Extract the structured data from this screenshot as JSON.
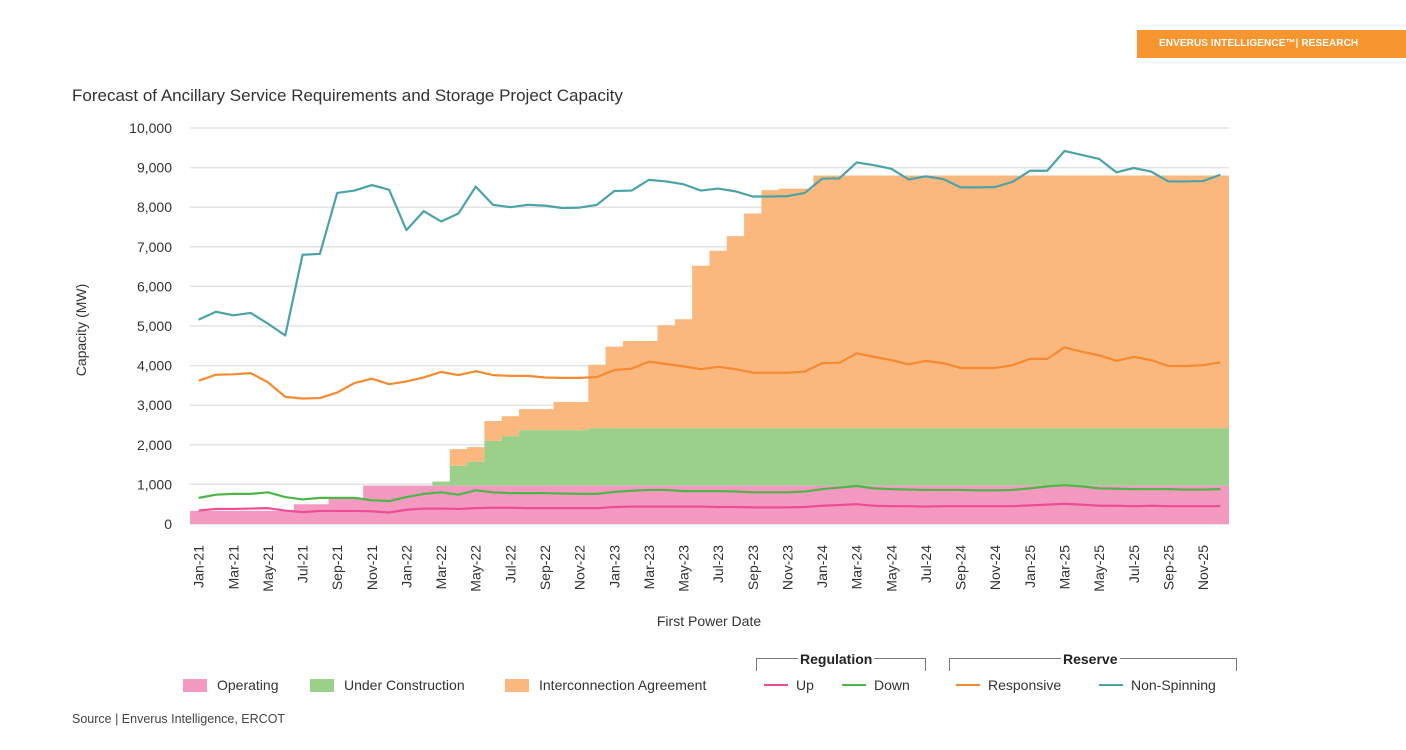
{
  "brand": {
    "label": "ENVERUS INTELLIGENCE™| RESEARCH",
    "color": "#f7952e"
  },
  "source": "Source | Enverus Intelligence, ERCOT",
  "legend_groups": {
    "regulation": "Regulation",
    "reserve": "Reserve"
  },
  "chart_data": {
    "type": "area",
    "title": "Forecast of Ancillary Service Requirements and Storage Project Capacity",
    "xlabel": "First Power Date",
    "ylabel": "Capacity (MW)",
    "ylim": [
      0,
      10000
    ],
    "yticks": [
      0,
      1000,
      2000,
      3000,
      4000,
      5000,
      6000,
      7000,
      8000,
      9000,
      10000
    ],
    "ytick_labels": [
      "0",
      "1,000",
      "2,000",
      "3,000",
      "4,000",
      "5,000",
      "6,000",
      "7,000",
      "8,000",
      "9,000",
      "10,000"
    ],
    "grid": true,
    "legend_position": "bottom",
    "x": [
      "Jan-21",
      "Feb-21",
      "Mar-21",
      "Apr-21",
      "May-21",
      "Jun-21",
      "Jul-21",
      "Aug-21",
      "Sep-21",
      "Oct-21",
      "Nov-21",
      "Dec-21",
      "Jan-22",
      "Feb-22",
      "Mar-22",
      "Apr-22",
      "May-22",
      "Jun-22",
      "Jul-22",
      "Aug-22",
      "Sep-22",
      "Oct-22",
      "Nov-22",
      "Dec-22",
      "Jan-23",
      "Feb-23",
      "Mar-23",
      "Apr-23",
      "May-23",
      "Jun-23",
      "Jul-23",
      "Aug-23",
      "Sep-23",
      "Oct-23",
      "Nov-23",
      "Dec-23",
      "Jan-24",
      "Feb-24",
      "Mar-24",
      "Apr-24",
      "May-24",
      "Jun-24",
      "Jul-24",
      "Aug-24",
      "Sep-24",
      "Oct-24",
      "Nov-24",
      "Dec-24",
      "Jan-25",
      "Feb-25",
      "Mar-25",
      "Apr-25",
      "May-25",
      "Jun-25",
      "Jul-25",
      "Aug-25",
      "Sep-25",
      "Oct-25",
      "Nov-25",
      "Dec-25"
    ],
    "xtick_labels": [
      "Jan-21",
      "Mar-21",
      "May-21",
      "Jul-21",
      "Sep-21",
      "Nov-21",
      "Jan-22",
      "Mar-22",
      "May-22",
      "Jul-22",
      "Sep-22",
      "Nov-22",
      "Jan-23",
      "Mar-23",
      "May-23",
      "Jul-23",
      "Sep-23",
      "Nov-23",
      "Jan-24",
      "Mar-24",
      "May-24",
      "Jul-24",
      "Sep-24",
      "Nov-24",
      "Jan-25",
      "Mar-25",
      "May-25",
      "Jul-25",
      "Sep-25",
      "Nov-25"
    ],
    "stacked_areas": [
      {
        "name": "Operating",
        "color": "#f49ac1",
        "values": [
          330,
          330,
          330,
          330,
          330,
          330,
          500,
          500,
          660,
          660,
          970,
          970,
          970,
          970,
          970,
          970,
          970,
          970,
          970,
          970,
          970,
          970,
          970,
          970,
          970,
          970,
          970,
          970,
          970,
          970,
          970,
          970,
          970,
          970,
          970,
          970,
          970,
          970,
          970,
          970,
          970,
          970,
          970,
          970,
          970,
          970,
          970,
          970,
          970,
          970,
          970,
          970,
          970,
          970,
          970,
          970,
          970,
          970,
          970,
          970
        ]
      },
      {
        "name": "Under Construction",
        "color": "#9bd08b",
        "values": [
          0,
          0,
          0,
          0,
          0,
          0,
          0,
          0,
          0,
          0,
          0,
          0,
          0,
          0,
          100,
          500,
          600,
          1130,
          1250,
          1400,
          1400,
          1400,
          1400,
          1450,
          1450,
          1450,
          1450,
          1450,
          1450,
          1450,
          1450,
          1450,
          1450,
          1450,
          1450,
          1450,
          1450,
          1450,
          1450,
          1450,
          1450,
          1450,
          1450,
          1450,
          1450,
          1450,
          1450,
          1450,
          1450,
          1450,
          1450,
          1450,
          1450,
          1450,
          1450,
          1450,
          1450,
          1450,
          1450,
          1450
        ]
      },
      {
        "name": "Interconnection Agreement",
        "color": "#fab87e",
        "values": [
          0,
          0,
          0,
          0,
          0,
          0,
          0,
          0,
          0,
          0,
          0,
          0,
          0,
          0,
          0,
          420,
          370,
          500,
          500,
          530,
          530,
          710,
          710,
          1600,
          2060,
          2200,
          2200,
          2600,
          2750,
          4100,
          4480,
          4850,
          5420,
          6010,
          6050,
          6050,
          6380,
          6380,
          6380,
          6380,
          6380,
          6380,
          6380,
          6380,
          6380,
          6380,
          6380,
          6380,
          6380,
          6380,
          6380,
          6380,
          6380,
          6380,
          6380,
          6380,
          6380,
          6380,
          6380,
          6380
        ]
      }
    ],
    "lines": [
      {
        "name": "Up",
        "group": "Regulation",
        "color": "#ec4d94",
        "values": [
          340,
          380,
          380,
          390,
          400,
          340,
          300,
          330,
          330,
          330,
          320,
          290,
          360,
          390,
          390,
          380,
          400,
          410,
          410,
          400,
          400,
          400,
          400,
          400,
          430,
          440,
          440,
          440,
          440,
          440,
          430,
          430,
          420,
          420,
          420,
          430,
          460,
          480,
          500,
          460,
          450,
          450,
          440,
          450,
          450,
          450,
          450,
          450,
          470,
          490,
          510,
          490,
          460,
          460,
          450,
          460,
          450,
          450,
          450,
          450
        ]
      },
      {
        "name": "Down",
        "group": "Regulation",
        "color": "#4cb749",
        "values": [
          660,
          740,
          760,
          760,
          800,
          680,
          620,
          660,
          660,
          660,
          600,
          580,
          680,
          760,
          800,
          740,
          850,
          800,
          780,
          780,
          780,
          770,
          760,
          760,
          810,
          840,
          860,
          860,
          830,
          830,
          830,
          820,
          800,
          800,
          800,
          820,
          880,
          920,
          960,
          900,
          880,
          870,
          860,
          860,
          860,
          850,
          850,
          860,
          900,
          950,
          980,
          950,
          900,
          890,
          880,
          880,
          880,
          870,
          870,
          880
        ]
      },
      {
        "name": "Responsive",
        "group": "Reserve",
        "color": "#f58a2e",
        "values": [
          3620,
          3770,
          3780,
          3810,
          3580,
          3210,
          3170,
          3180,
          3320,
          3560,
          3670,
          3530,
          3600,
          3700,
          3840,
          3760,
          3860,
          3760,
          3740,
          3740,
          3700,
          3690,
          3690,
          3710,
          3890,
          3920,
          4100,
          4040,
          3980,
          3910,
          3970,
          3910,
          3820,
          3820,
          3820,
          3850,
          4060,
          4070,
          4310,
          4220,
          4140,
          4030,
          4120,
          4060,
          3940,
          3940,
          3940,
          4010,
          4170,
          4170,
          4460,
          4350,
          4260,
          4120,
          4220,
          4140,
          3990,
          3990,
          4010,
          4080
        ]
      },
      {
        "name": "Non-Spinning",
        "group": "Reserve",
        "color": "#4ba3a8",
        "values": [
          5160,
          5360,
          5270,
          5330,
          5060,
          4760,
          6800,
          6820,
          8360,
          8420,
          8560,
          8440,
          7420,
          7900,
          7640,
          7840,
          8520,
          8060,
          8000,
          8060,
          8040,
          7980,
          7990,
          8060,
          8410,
          8420,
          8690,
          8650,
          8580,
          8420,
          8470,
          8400,
          8270,
          8270,
          8280,
          8360,
          8720,
          8730,
          9130,
          9060,
          8970,
          8700,
          8780,
          8710,
          8500,
          8500,
          8510,
          8640,
          8920,
          8920,
          9420,
          9320,
          9220,
          8880,
          8990,
          8900,
          8650,
          8650,
          8660,
          8820
        ]
      }
    ]
  }
}
